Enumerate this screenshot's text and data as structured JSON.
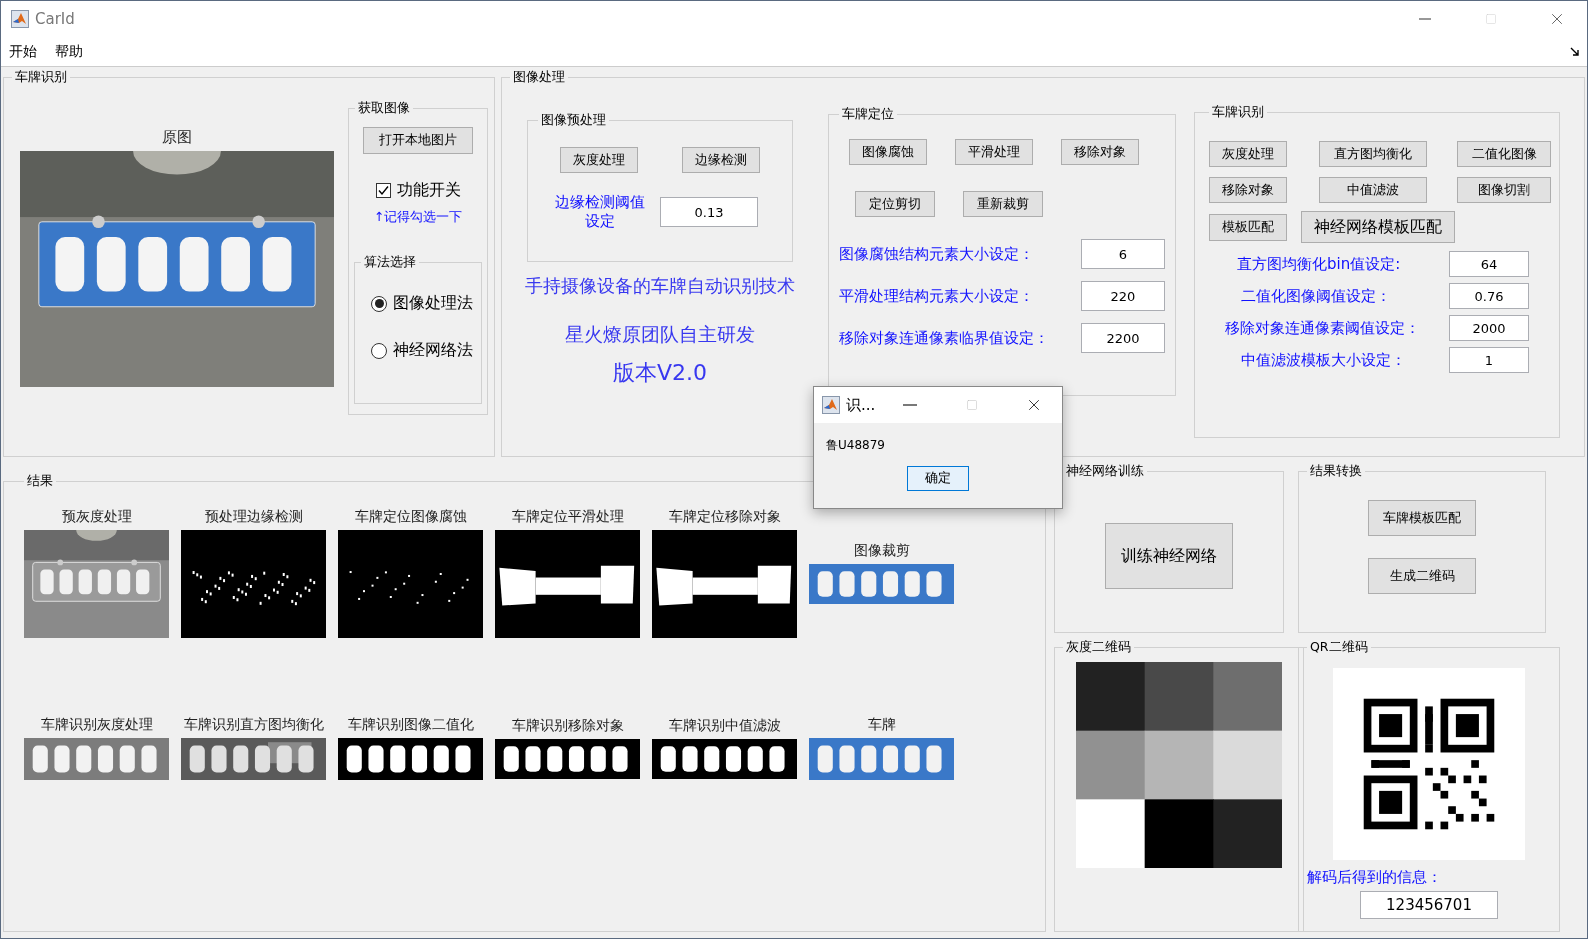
{
  "window": {
    "title": "CarId"
  },
  "menu": [
    "开始",
    "帮助"
  ],
  "recognition_panel": {
    "title": "车牌识别",
    "image_caption": "原图",
    "acquire": {
      "title": "获取图像",
      "button": "打开本地图片",
      "checkbox": {
        "label": "功能开关",
        "checked": true
      },
      "hint": "↑记得勾选一下"
    },
    "algorithm": {
      "title": "算法选择",
      "options": [
        {
          "label": "图像处理法",
          "selected": true
        },
        {
          "label": "神经网络法",
          "selected": false
        }
      ]
    }
  },
  "processing_panel": {
    "title": "图像处理",
    "preprocess": {
      "title": "图像预处理",
      "buttons": [
        "灰度处理",
        "边缘检测"
      ],
      "threshold_label": "边缘检测阈值设定",
      "threshold_value": "0.13"
    },
    "info": [
      "手持摄像设备的车牌自动识别技术",
      "星火燎原团队自主研发",
      "版本V2.0"
    ],
    "locate": {
      "title": "车牌定位",
      "buttons": [
        "图像腐蚀",
        "平滑处理",
        "移除对象",
        "定位剪切",
        "重新裁剪"
      ],
      "settings": [
        {
          "label": "图像腐蚀结构元素大小设定：",
          "value": "6"
        },
        {
          "label": "平滑处理结构元素大小设定：",
          "value": "220"
        },
        {
          "label": "移除对象连通像素临界值设定：",
          "value": "2200"
        }
      ]
    },
    "recognize": {
      "title": "车牌识别",
      "buttons": [
        "灰度处理",
        "直方图均衡化",
        "二值化图像",
        "移除对象",
        "中值滤波",
        "图像切割",
        "模板匹配",
        "神经网络模板匹配"
      ],
      "settings": [
        {
          "label": "直方图均衡化bin值设定:",
          "value": "64"
        },
        {
          "label": "二值化图像阈值设定：",
          "value": "0.76"
        },
        {
          "label": "移除对象连通像素阈值设定：",
          "value": "2000"
        },
        {
          "label": "中值滤波模板大小设定：",
          "value": "1"
        }
      ]
    }
  },
  "results": {
    "title": "结果",
    "images": [
      {
        "caption": "预灰度处理"
      },
      {
        "caption": "预处理边缘检测"
      },
      {
        "caption": "车牌定位图像腐蚀"
      },
      {
        "caption": "车牌定位平滑处理"
      },
      {
        "caption": "车牌定位移除对象"
      },
      {
        "caption": "图像裁剪"
      },
      {
        "caption": "车牌识别灰度处理"
      },
      {
        "caption": "车牌识别直方图均衡化"
      },
      {
        "caption": "车牌识别图像二值化"
      },
      {
        "caption": "车牌识别移除对象"
      },
      {
        "caption": "车牌识别中值滤波"
      },
      {
        "caption": "车牌"
      }
    ]
  },
  "training": {
    "title": "神经网络训练",
    "button": "训练神经网络"
  },
  "conversion": {
    "title": "结果转换",
    "buttons": [
      "车牌模板匹配",
      "生成二维码"
    ]
  },
  "gray_code": {
    "title": "灰度二维码"
  },
  "qr_code": {
    "title": "QR二维码",
    "decoded_label": "解码后得到的信息：",
    "decoded_value": "123456701"
  },
  "dialog": {
    "title": "识...",
    "message": "鲁U48879",
    "button": "确定"
  }
}
